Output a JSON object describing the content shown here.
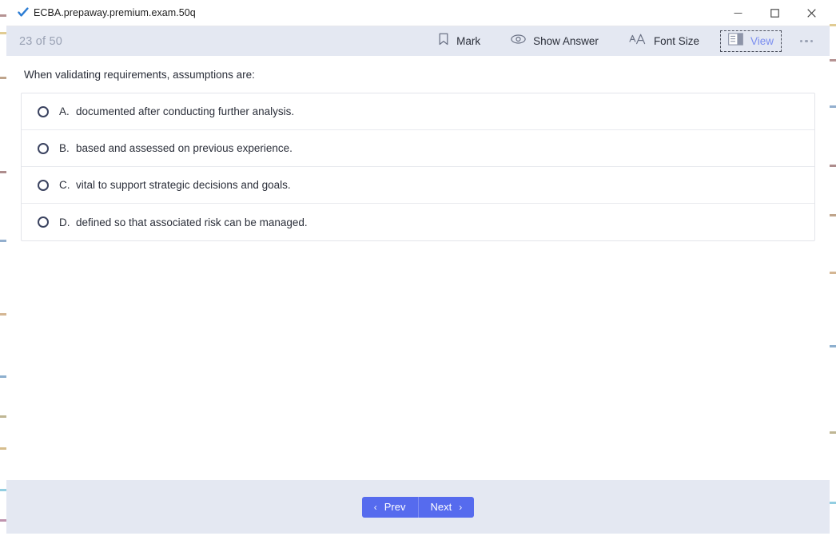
{
  "window": {
    "title": "ECBA.prepaway.premium.exam.50q",
    "app_icon": "blue-check-icon",
    "controls": {
      "minimize": "—",
      "maximize": "☐",
      "close": "✕"
    }
  },
  "toolbar": {
    "progress": "23 of 50",
    "buttons": [
      {
        "id": "mark",
        "label": "Mark",
        "icon": "bookmark-icon",
        "focused": false
      },
      {
        "id": "show-answer",
        "label": "Show Answer",
        "icon": "eye-icon",
        "focused": false
      },
      {
        "id": "font-size",
        "label": "Font Size",
        "icon": "font-size-icon",
        "focused": false
      },
      {
        "id": "view",
        "label": "View",
        "icon": "layout-icon",
        "focused": true
      }
    ],
    "more_label": "more-options"
  },
  "question": {
    "prompt": "When validating requirements, assumptions are:",
    "options": [
      {
        "letter": "A.",
        "text": "documented after conducting further analysis.",
        "selected": false
      },
      {
        "letter": "B.",
        "text": "based and assessed on previous experience.",
        "selected": false
      },
      {
        "letter": "C.",
        "text": "vital to support strategic decisions and goals.",
        "selected": false
      },
      {
        "letter": "D.",
        "text": "defined so that associated risk can be managed.",
        "selected": false
      }
    ]
  },
  "footer": {
    "prev_label": "Prev",
    "next_label": "Next",
    "prev_chevron": "‹",
    "next_chevron": "›"
  },
  "colors": {
    "toolbar_bg": "#e4e8f2",
    "accent_blue": "#566bee",
    "focus_text": "#7b8ef0",
    "muted_text": "#9aa2b4",
    "body_text": "#2b2f3a"
  }
}
